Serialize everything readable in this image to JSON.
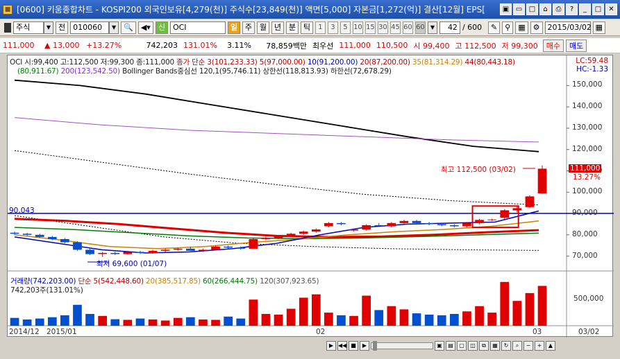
{
  "window": {
    "title": "[0600] 키움종합차트 - KOSPI200 외국인보유[4,279(천)] 주식수[23,849(천)] 액면[5,000] 자본금[1,272(억)] 결산[12월] EPS[",
    "icons": [
      "chart-icon",
      "restore-icon",
      "fullscreen-icon",
      "save-icon",
      "print-icon",
      "help-icon",
      "minimize-icon",
      "maximize-icon",
      "close-icon"
    ]
  },
  "toolbar": {
    "market_type": "주식",
    "prev_label": "전",
    "code": "010060",
    "credit_badge": "신",
    "stock_name": "OCI",
    "periods": [
      "일",
      "주",
      "월",
      "년",
      "분",
      "틱"
    ],
    "active_period": "일",
    "minute_options": [
      "1",
      "3",
      "5",
      "10",
      "15",
      "30",
      "45",
      "60",
      "60"
    ],
    "count": "42",
    "total": "/ 600",
    "date": "2015/03/02"
  },
  "quote": {
    "price": "111,000",
    "change": "▲ 13,000",
    "change_pct": "+13.27%",
    "volume": "742,203",
    "vol_ratio": "131.01%",
    "turnover": "3.11%",
    "amount": "78,859백만",
    "best_label": "최우선",
    "best_bid": "111,000",
    "best_ask": "110,500",
    "open": "시 99,400",
    "high": "고 112,500",
    "low": "저 99,300",
    "buy": "매수",
    "sell": "매도"
  },
  "chart": {
    "legend1_ohlc": "OCI 시:99,400 고:112,500 저:99,300 종:111,000",
    "legend1_ma": "종가 단순 3(101,233.33)",
    "legend1_ma5": "5(97,000.00)",
    "legend1_ma10": "10(91,200.00)",
    "legend1_ma20": "20(87,200.00)",
    "legend1_ma35": "35(81,314.29)",
    "legend1_ma44": "44(80,443.18)",
    "legend2_ma100": "(80,911.67)",
    "legend2_ma200": "200(123,542.50)",
    "legend2_bb": "Bollinger Bands중심선 120,1(95,746.11)",
    "legend2_upper": "상한선(118,813.93)",
    "legend2_lower": "하한선(72,678.29)",
    "lc": "LC:59.48",
    "hc": "HC:-1.33",
    "y_ticks": [
      "150,000",
      "140,000",
      "130,000",
      "120,000",
      "110,000",
      "100,000",
      "90,000",
      "80,000",
      "70,000"
    ],
    "hline_label": "90,043",
    "high_annotation": "최고 112,500 (03/02)",
    "low_annotation": "최저 69,600 (01/07)",
    "last_price_tag": "111,000",
    "last_pct_tag": "13.27%",
    "vol_legend": "거래량(742,203.00)",
    "vol_ma5": "단순 5(542,448.60)",
    "vol_ma20": "20(385,517.85)",
    "vol_ma60": "60(266,444.75)",
    "vol_ma120": "120(307,923.65)",
    "vol_current": "742,203주(131.01%)",
    "vol_tick": "500,000",
    "x_labels": [
      "2014/12",
      "2015/01",
      "02",
      "03",
      "03/02"
    ]
  },
  "chart_data": {
    "type": "candlestick",
    "title": "OCI",
    "candles": [
      [
        81000,
        81500,
        80000,
        80500
      ],
      [
        80500,
        81000,
        79500,
        80000
      ],
      [
        80000,
        80500,
        78500,
        79000
      ],
      [
        79000,
        79500,
        77500,
        78000
      ],
      [
        78000,
        78500,
        76000,
        76500
      ],
      [
        76500,
        77000,
        72500,
        73000
      ],
      [
        73000,
        73500,
        70500,
        71000
      ],
      [
        71000,
        72000,
        69600,
        71500
      ],
      [
        71500,
        72000,
        70500,
        71000
      ],
      [
        71000,
        72500,
        70800,
        72000
      ],
      [
        72000,
        72500,
        71000,
        71500
      ],
      [
        71500,
        73000,
        71200,
        72500
      ],
      [
        72500,
        73500,
        72000,
        73000
      ],
      [
        73000,
        74000,
        72500,
        73500
      ],
      [
        73500,
        74500,
        73000,
        72500
      ],
      [
        72500,
        73500,
        72000,
        73000
      ],
      [
        73000,
        75000,
        72800,
        74500
      ],
      [
        74500,
        75000,
        73500,
        74000
      ],
      [
        74000,
        74500,
        73000,
        73500
      ],
      [
        73500,
        78500,
        73500,
        78000
      ],
      [
        78000,
        79000,
        77500,
        78500
      ],
      [
        78500,
        80000,
        78000,
        79500
      ],
      [
        79500,
        81000,
        79000,
        80500
      ],
      [
        80500,
        82000,
        80000,
        81500
      ],
      [
        81500,
        83000,
        81000,
        82500
      ],
      [
        84000,
        86000,
        83500,
        85500
      ],
      [
        85500,
        86000,
        84500,
        85000
      ],
      [
        82000,
        83000,
        81500,
        82500
      ],
      [
        82500,
        85000,
        82000,
        84500
      ],
      [
        84500,
        85500,
        84000,
        84000
      ],
      [
        84000,
        86000,
        83500,
        85500
      ],
      [
        85500,
        87000,
        85000,
        86500
      ],
      [
        86500,
        87000,
        85000,
        85500
      ],
      [
        85500,
        86000,
        84500,
        85000
      ],
      [
        85000,
        85500,
        84000,
        84500
      ],
      [
        84500,
        85000,
        83500,
        84000
      ],
      [
        84000,
        86000,
        83500,
        85500
      ],
      [
        85500,
        87500,
        85000,
        87000
      ],
      [
        87000,
        87500,
        86500,
        87200
      ],
      [
        88000,
        92000,
        87500,
        91500
      ],
      [
        91500,
        93500,
        90500,
        92500
      ],
      [
        93000,
        98500,
        92500,
        98000
      ],
      [
        99400,
        112500,
        99300,
        111000
      ]
    ],
    "volume": [
      120000,
      95000,
      110000,
      130000,
      160000,
      320000,
      180000,
      150000,
      100000,
      90000,
      110000,
      95000,
      80000,
      120000,
      130000,
      95000,
      90000,
      140000,
      110000,
      400000,
      180000,
      170000,
      260000,
      430000,
      480000,
      200000,
      160000,
      150000,
      460000,
      240000,
      300000,
      250000,
      190000,
      170000,
      160000,
      180000,
      220000,
      300000,
      200000,
      670000,
      380000,
      500000,
      610000
    ],
    "ylim": [
      65000,
      155000
    ],
    "ma": {
      "ma200": [
        152000,
        148000,
        142000,
        136000,
        130000,
        124000,
        118500
      ],
      "ma200_note": "down-sloping black line",
      "bb_upper": [
        134000,
        128000,
        123000,
        122000,
        124000
      ],
      "bb_lower": [
        90000,
        85000,
        80000,
        76000,
        73000,
        72678
      ]
    },
    "hline": 90043
  }
}
